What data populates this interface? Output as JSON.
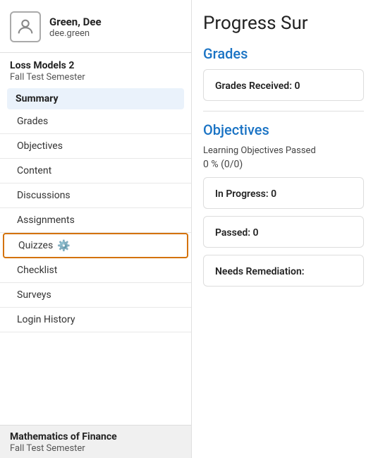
{
  "user": {
    "name": "Green, Dee",
    "username": "dee.green"
  },
  "sidebar": {
    "current_course": {
      "name": "Loss Models 2",
      "semester": "Fall Test Semester"
    },
    "active_item": "Summary",
    "nav_items": [
      {
        "id": "grades",
        "label": "Grades"
      },
      {
        "id": "objectives",
        "label": "Objectives"
      },
      {
        "id": "content",
        "label": "Content"
      },
      {
        "id": "discussions",
        "label": "Discussions"
      },
      {
        "id": "assignments",
        "label": "Assignments"
      },
      {
        "id": "quizzes",
        "label": "Quizzes",
        "icon": true,
        "active_border": true
      },
      {
        "id": "checklist",
        "label": "Checklist"
      },
      {
        "id": "surveys",
        "label": "Surveys"
      },
      {
        "id": "login-history",
        "label": "Login History"
      }
    ],
    "second_course": {
      "name": "Mathematics of Finance",
      "semester": "Fall Test Semester"
    }
  },
  "main": {
    "page_title": "Progress Sur",
    "grades_section": {
      "heading": "Grades",
      "card_label": "Grades Received: 0"
    },
    "objectives_section": {
      "heading": "Objectives",
      "subtitle": "Learning Objectives Passed",
      "percent": "0 % (0/0)",
      "in_progress_label": "In Progress: 0",
      "passed_label": "Passed: 0",
      "needs_remediation_label": "Needs Remediation:"
    }
  }
}
